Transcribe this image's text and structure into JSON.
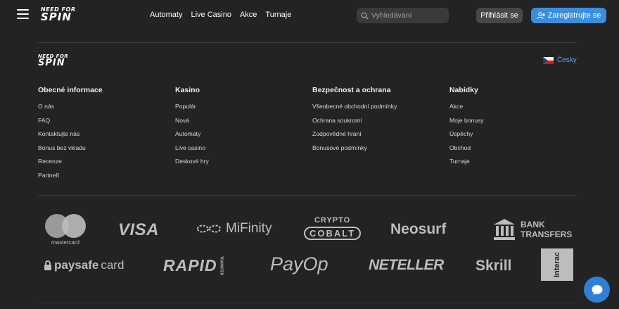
{
  "header": {
    "logo_line1": "NEED FOR",
    "logo_line2": "SPIN",
    "nav": [
      "Automaty",
      "Live Casino",
      "Akce",
      "Turnaje"
    ],
    "search_placeholder": "Vyhledávání",
    "login_label": "Přihlásit se",
    "register_label": "Zaregistrujte se",
    "accent": "#3a8ee0"
  },
  "footer": {
    "logo_line1": "NEED FOR",
    "logo_line2": "SPIN",
    "language": "Česky",
    "columns": [
      {
        "title": "Obecné informace",
        "items": [
          "O nás",
          "FAQ",
          "Kontaktujte nás",
          "Bonus bez vkladu",
          "Recenze",
          "Partneři"
        ]
      },
      {
        "title": "Kasino",
        "items": [
          "Populár",
          "Nová",
          "Automaty",
          "Live casino",
          "Deskové hry"
        ]
      },
      {
        "title": "Bezpečnost a ochrana",
        "items": [
          "Všeobecné obchodní podmínky",
          "Ochrana soukromí",
          "Zodpovědné hraní",
          "Bonusové podmínky"
        ]
      },
      {
        "title": "Nabídky",
        "items": [
          "Akce",
          "Moje bonusy",
          "Úspěchy",
          "Obchod",
          "Turnaje"
        ]
      }
    ]
  },
  "payments": {
    "mastercard": "mastercard",
    "visa": "VISA",
    "mifinity": "MiFinity",
    "crypto_top": "CRYPTO",
    "crypto_bottom": "COBALT",
    "neosurf": "Neosurf",
    "bank_line1": "BANK",
    "bank_line2": "TRANSFERS",
    "paysafe_a": "paysafe",
    "paysafe_b": "card",
    "rapid": "RAPID",
    "rapid_sub": "TRANSFER",
    "payop": "PayOp",
    "neteller": "NETELLER",
    "skrill": "Skrill",
    "interac": "Interac"
  }
}
